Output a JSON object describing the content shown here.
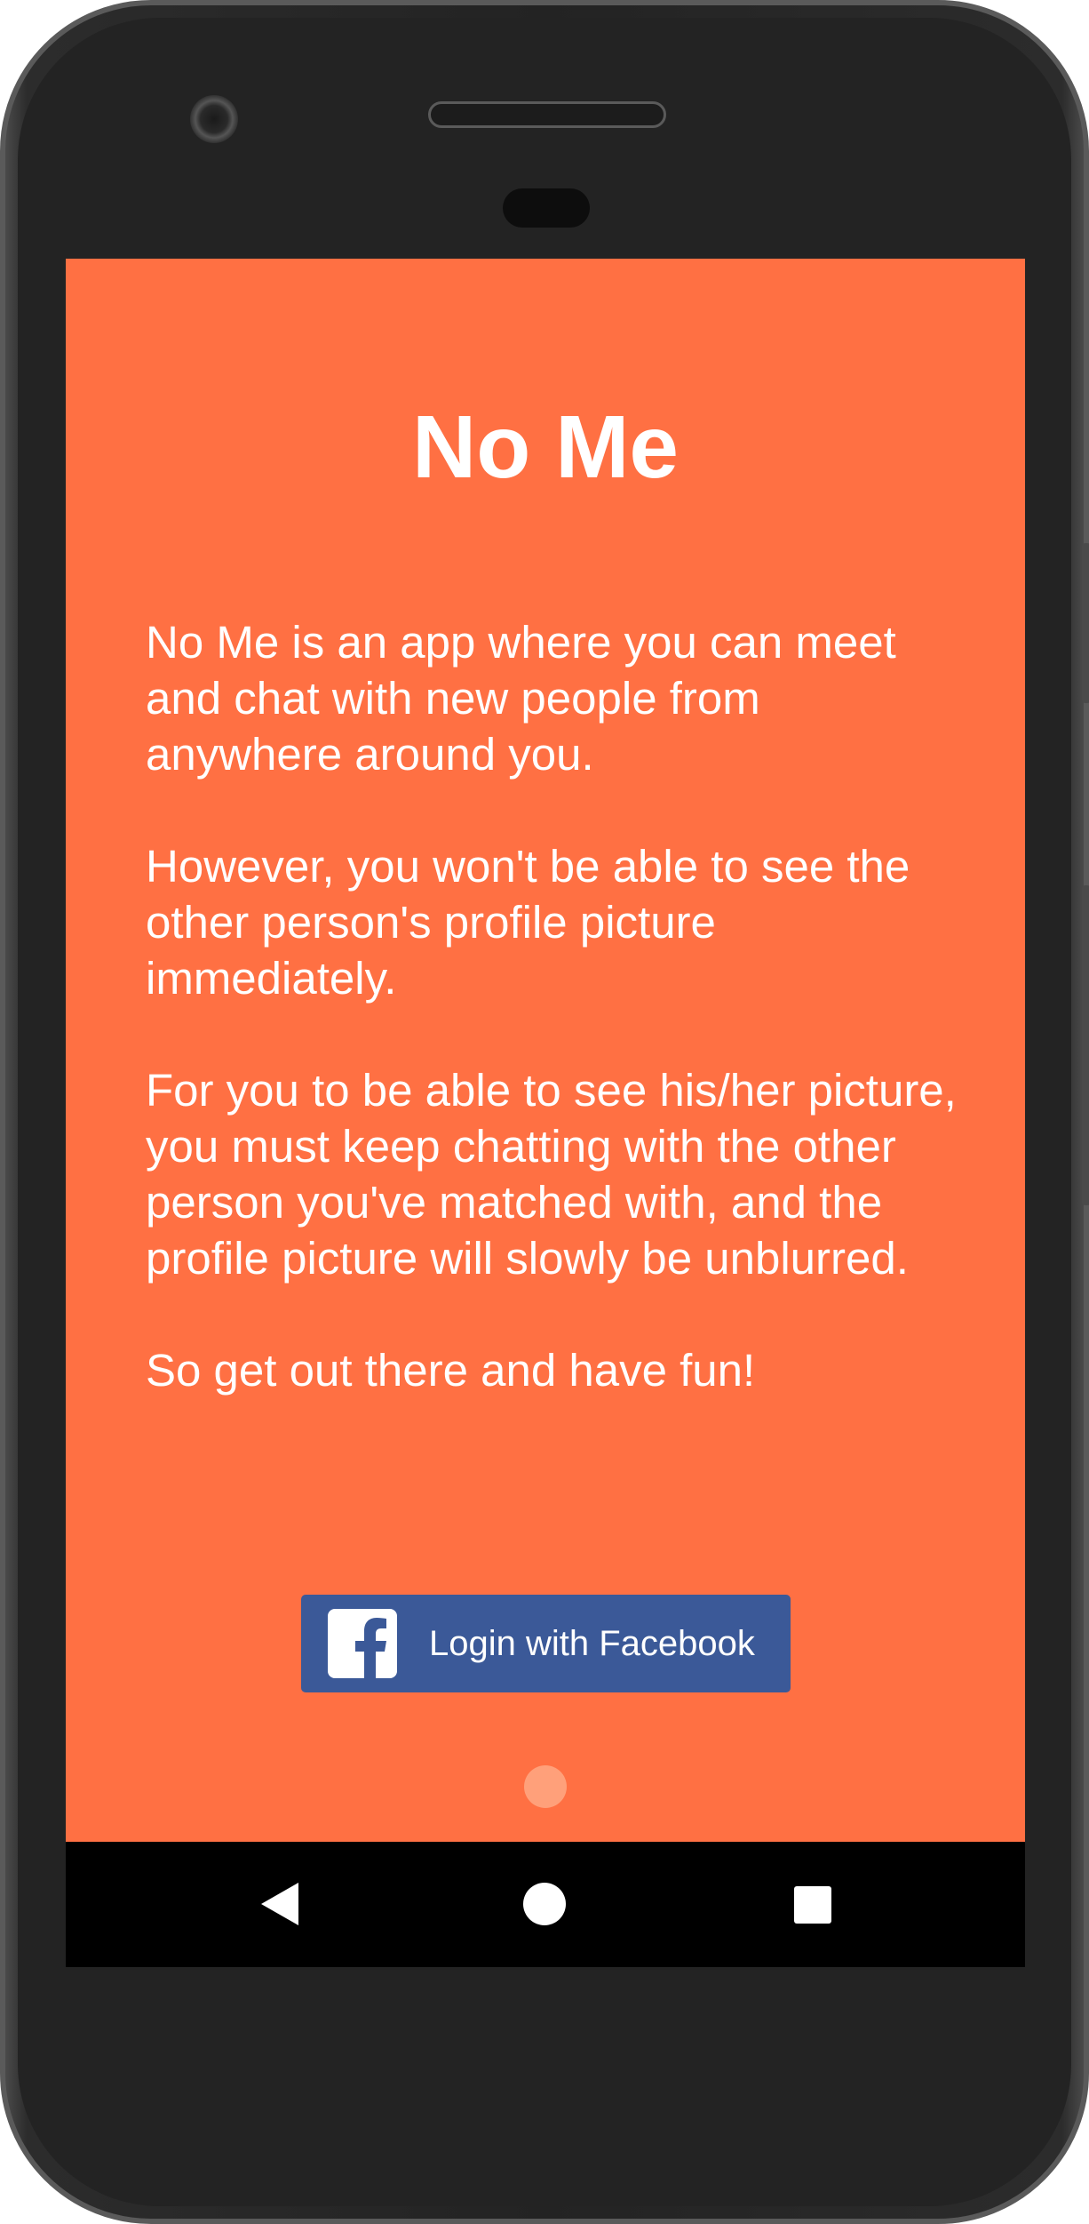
{
  "app": {
    "title": "No Me"
  },
  "intro": {
    "paragraphs": [
      "No Me is an app where you can meet and chat with new people from anywhere around you.",
      "However, you won't be able to see the other person's profile picture immediately.",
      "For you to be able to see his/her picture, you must keep chatting with the other person you've matched with, and the profile picture will slowly be unblurred.",
      "So get out there and have fun!"
    ]
  },
  "login": {
    "facebook_label": "Login with Facebook",
    "icon": "facebook-icon"
  },
  "pager": {
    "pages": 1,
    "current": 1
  },
  "navigation": {
    "back_icon": "back-icon",
    "home_icon": "home-icon",
    "recents_icon": "recents-icon"
  },
  "colors": {
    "background": "#ff7043",
    "facebook_blue": "#3b5998",
    "page_dot": "#ffa07a",
    "text": "#ffffff"
  }
}
